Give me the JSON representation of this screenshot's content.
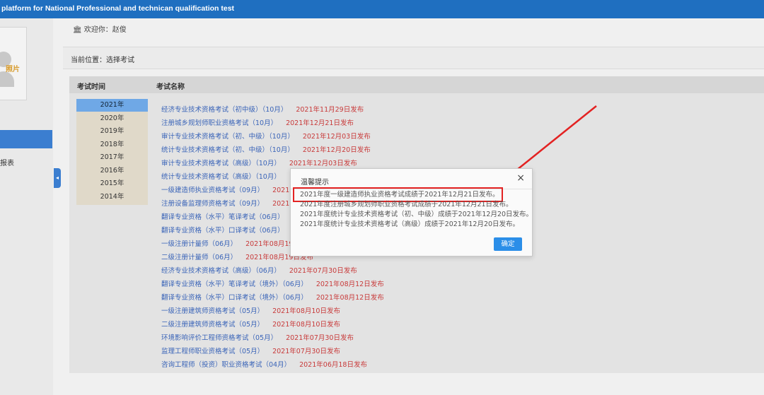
{
  "header": {
    "title": "platform for National Professional and technican qualification test"
  },
  "sidebar": {
    "photo_label": "照片",
    "menu_label": "报表"
  },
  "topstrip": {
    "welcome": "欢迎你：赵俊",
    "breadcrumb": "当前位置：选择考试"
  },
  "table": {
    "col_time": "考试时间",
    "col_name": "考试名称",
    "years": [
      "2021年",
      "2020年",
      "2019年",
      "2018年",
      "2017年",
      "2016年",
      "2015年",
      "2014年"
    ],
    "selected_year": "2021年",
    "exams": [
      {
        "name": "经济专业技术资格考试（初中级）（10月）",
        "date": "2021年11月29日发布"
      },
      {
        "name": "注册城乡规划师职业资格考试（10月）",
        "date": "2021年12月21日发布"
      },
      {
        "name": "审计专业技术资格考试（初、中级）（10月）",
        "date": "2021年12月03日发布"
      },
      {
        "name": "统计专业技术资格考试（初、中级）（10月）",
        "date": "2021年12月20日发布"
      },
      {
        "name": "审计专业技术资格考试（高级）（10月）",
        "date": "2021年12月03日发布"
      },
      {
        "name": "统计专业技术资格考试（高级）（10月）",
        "date": ""
      },
      {
        "name": "一级建造师执业资格考试（09月）",
        "date": "2021"
      },
      {
        "name": "注册设备监理师资格考试（09月）",
        "date": "2021"
      },
      {
        "name": "翻译专业资格（水平）笔译考试（06月）",
        "date": ""
      },
      {
        "name": "翻译专业资格（水平）口译考试（06月）",
        "date": ""
      },
      {
        "name": "一级注册计量师（06月）",
        "date": "2021年08月19日"
      },
      {
        "name": "二级注册计量师（06月）",
        "date": "2021年08月19日发布"
      },
      {
        "name": "经济专业技术资格考试（高级）（06月）",
        "date": "2021年07月30日发布"
      },
      {
        "name": "翻译专业资格（水平）笔译考试（境外）（06月）",
        "date": "2021年08月12日发布"
      },
      {
        "name": "翻译专业资格（水平）口译考试（境外）（06月）",
        "date": "2021年08月12日发布"
      },
      {
        "name": "一级注册建筑师资格考试（05月）",
        "date": "2021年08月10日发布"
      },
      {
        "name": "二级注册建筑师资格考试（05月）",
        "date": "2021年08月10日发布"
      },
      {
        "name": "环境影响评价工程师资格考试（05月）",
        "date": "2021年07月30日发布"
      },
      {
        "name": "监理工程师职业资格考试（05月）",
        "date": "2021年07月30日发布"
      },
      {
        "name": "咨询工程师（投资）职业资格考试（04月）",
        "date": "2021年06月18日发布"
      }
    ]
  },
  "modal": {
    "title": "温馨提示",
    "lines": [
      "2021年度一级建造师执业资格考试成绩于2021年12月21日发布。",
      "2021年度注册城乡规划师职业资格考试成绩于2021年12月21日发布。",
      "2021年度统计专业技术资格考试（初、中级）成绩于2021年12月20日发布。",
      "2021年度统计专业技术资格考试（高级）成绩于2021年12月20日发布。"
    ],
    "ok_label": "确定",
    "close_glyph": "×"
  },
  "colors": {
    "brand": "#1f6fc0",
    "link": "#3a64b8",
    "date": "#c83a3a",
    "highlight": "#e32222",
    "ok": "#2b8ee8"
  }
}
